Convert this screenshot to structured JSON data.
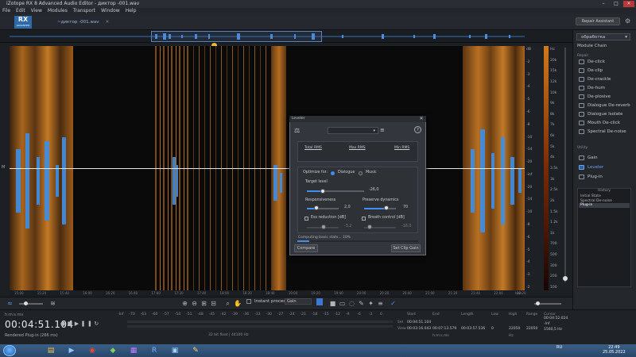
{
  "window": {
    "title": "iZotope RX 8 Advanced Audio Editor - диктор -001.wav"
  },
  "menu": [
    "File",
    "Edit",
    "View",
    "Modules",
    "Transport",
    "Window",
    "Help"
  ],
  "logo": {
    "text": "RX",
    "sub": "ADVANCED"
  },
  "file_tab": {
    "label": "~диктор -001.wav"
  },
  "repair_assistant": "Repair Assistant",
  "right_panel": {
    "preset": "обработка",
    "module_chain": "Module Chain",
    "repair_header": "Repair",
    "repair_modules": [
      "De-click",
      "De-clip",
      "De-crackle",
      "De-hum",
      "De-plosive",
      "Dialogue De-reverb",
      "Dialogue Isolate",
      "Mouth De-click",
      "Spectral De-noise"
    ],
    "utility_header": "Utility",
    "utility_modules": [
      "Gain",
      "Leveler",
      "Plug-in"
    ],
    "active_module": "Leveler",
    "history_title": "History",
    "history": [
      "Initial State",
      "Spectral De-noise",
      "Plug-in"
    ],
    "history_selected": "Plug-in"
  },
  "dialog": {
    "title": "Leveler",
    "stats": {
      "total_rms": "Total RMS",
      "max_rms": "Max RMS",
      "min_rms": "Min RMS"
    },
    "optimize_for_label": "Optimize for:",
    "optimize_options": [
      "Dialogue",
      "Music"
    ],
    "optimize_selected": "Dialogue",
    "target_level": {
      "label": "Target level",
      "value": "-26,0",
      "fraction": 0.28
    },
    "responsiveness": {
      "label": "Responsiveness",
      "value": "2,0",
      "fraction": 0.3
    },
    "preserve_dynamics": {
      "label": "Preserve dynamics",
      "value": "70",
      "fraction": 0.7
    },
    "ess_reduction": {
      "label": "Ess reduction [dB]",
      "value": "-3,2",
      "checked": false
    },
    "breath_control": {
      "label": "Breath control [dB]",
      "value": "-16,0",
      "checked": false
    },
    "status": "Computing basic stats... 10%",
    "progress": 0.1,
    "compare": "Compare",
    "set_clip_gain": "Set Clip Gain"
  },
  "toolbar": {
    "instant_process": "Instant process",
    "instant_mode": "Gain"
  },
  "time_axis": [
    "15:00",
    "15:20",
    "15:40",
    "16:00",
    "16:20",
    "16:40",
    "17:00",
    "17:20",
    "17:40",
    "18:00",
    "18:20",
    "18:40",
    "19:00",
    "19:20",
    "19:40",
    "20:00",
    "20:20",
    "20:40",
    "21:00",
    "21:20",
    "21:40",
    "22:00",
    "22:20"
  ],
  "time_axis_unit": "hms",
  "level_scale_left": [
    "dB",
    "-2",
    "-3",
    "-4",
    "-5",
    "-6",
    "-8",
    "-10",
    "-14",
    "-20",
    "-inf",
    "-20",
    "-14",
    "-10",
    "-8",
    "-6",
    "-5",
    "-4",
    "-3",
    "-2"
  ],
  "level_scale_right": [
    "Hz",
    "20k",
    "15k",
    "12k",
    "10k",
    "9k",
    "8k",
    "7k",
    "6k",
    "5k",
    "4k",
    "3.5k",
    "3k",
    "2.5k",
    "2k",
    "1.5k",
    "1.2k",
    "1k",
    "700",
    "500",
    "300",
    "200",
    "100"
  ],
  "status": {
    "format": "h:m:s.ms",
    "timecode": "00:04:51.104",
    "rendered": "Rendered Plug-in (266 ms)",
    "meter_scale": [
      "-Inf",
      "-70",
      "-63",
      "-60",
      "-57",
      "-54",
      "-51",
      "-48",
      "-45",
      "-42",
      "-39",
      "-36",
      "-33",
      "-30",
      "-27",
      "-24",
      "-21",
      "-18",
      "-15",
      "-12",
      "-9",
      "-6",
      "-3",
      "0"
    ],
    "bit_info": "32 bit float | 44100 Hz",
    "selection": {
      "headers": [
        "Start",
        "End",
        "Length",
        "Low",
        "High",
        "Range",
        "Cursor"
      ],
      "sel_label": "Sel",
      "view_label": "View",
      "sel": [
        "00:04:51.104",
        "",
        "",
        "",
        "",
        ""
      ],
      "view": [
        "00:03:16.043",
        "00:07:13.579",
        "00:03:57.536",
        "0",
        "22050",
        "22050"
      ],
      "format": "h:m:s.ms",
      "hz": "Hz",
      "cursor": [
        "00:04:52.024",
        "-Inf",
        "1560,5 Hz"
      ]
    }
  },
  "taskbar": {
    "lang": "RU",
    "time": "22:49",
    "date": "25.05.2022"
  }
}
